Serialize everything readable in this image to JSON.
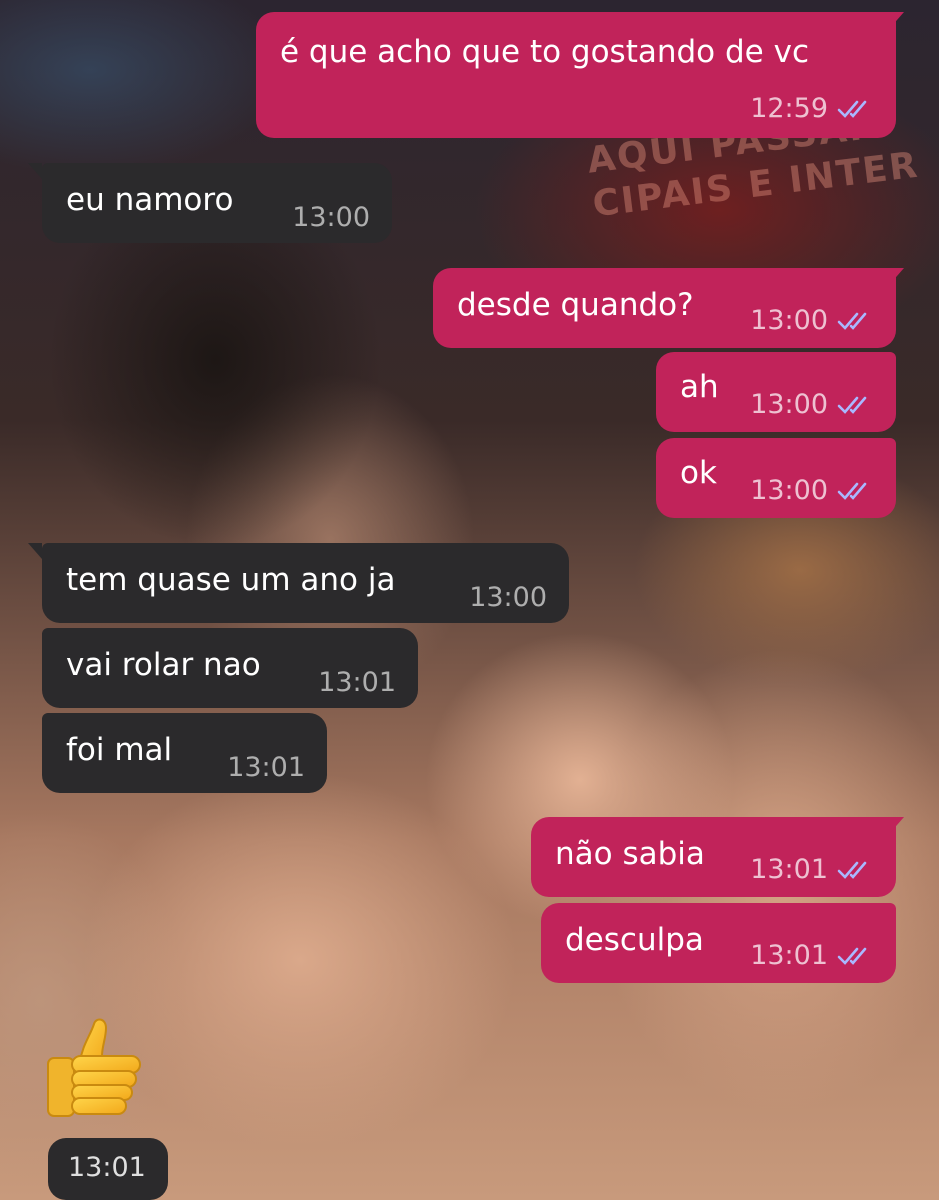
{
  "chat": {
    "messages": [
      {
        "id": "m1",
        "direction": "outgoing",
        "text": "é que acho que to gostando de vc",
        "time": "12:59",
        "status": "read"
      },
      {
        "id": "m2",
        "direction": "incoming",
        "text": "eu namoro",
        "time": "13:00"
      },
      {
        "id": "m3",
        "direction": "outgoing",
        "text": "desde quando?",
        "time": "13:00",
        "status": "read"
      },
      {
        "id": "m4",
        "direction": "outgoing",
        "text": "ah",
        "time": "13:00",
        "status": "read"
      },
      {
        "id": "m5",
        "direction": "outgoing",
        "text": "ok",
        "time": "13:00",
        "status": "read"
      },
      {
        "id": "m6",
        "direction": "incoming",
        "text": "tem quase um ano ja",
        "time": "13:00"
      },
      {
        "id": "m7",
        "direction": "incoming",
        "text": "vai rolar nao",
        "time": "13:01"
      },
      {
        "id": "m8",
        "direction": "incoming",
        "text": "foi mal",
        "time": "13:01"
      },
      {
        "id": "m9",
        "direction": "outgoing",
        "text": "não sabia",
        "time": "13:01",
        "status": "read"
      },
      {
        "id": "m10",
        "direction": "outgoing",
        "text": "desculpa",
        "time": "13:01",
        "status": "read"
      },
      {
        "id": "m11",
        "direction": "incoming",
        "emoji": "thumbs-up",
        "time": "13:01"
      }
    ]
  },
  "background": {
    "poster_lines": [
      "AQUI PASSAM",
      "CIPAIS E INTER"
    ]
  },
  "colors": {
    "outgoing_bubble": "#c1235a",
    "incoming_bubble": "#2b2a2c",
    "read_check": "#a9b8ff",
    "text": "#ffffff"
  },
  "icons": {
    "read_status": "double-check-icon",
    "sticker": "thumbs-up-emoji"
  }
}
